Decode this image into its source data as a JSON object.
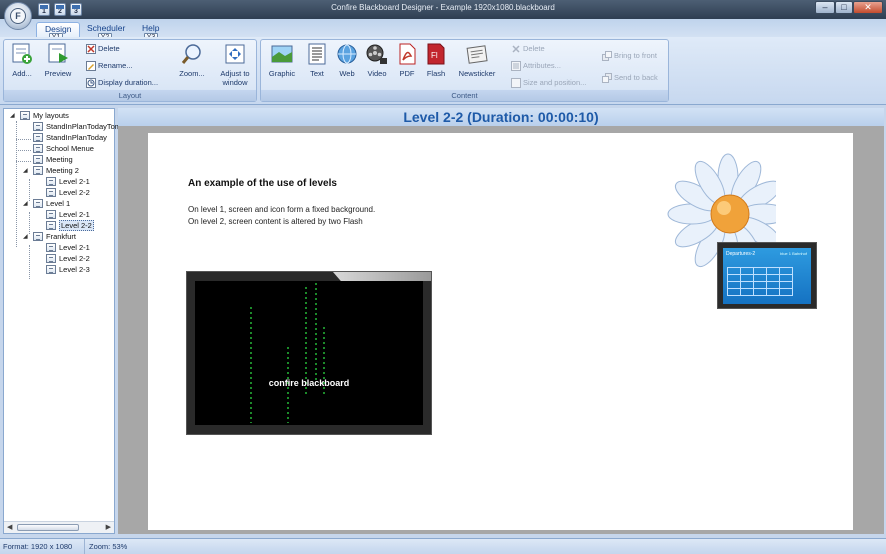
{
  "window": {
    "title": "Confire Blackboard Designer - Example 1920x1080.blackboard",
    "app_button_letter": "F",
    "quick_access": [
      "1",
      "2",
      "3"
    ],
    "controls": {
      "minimize": "–",
      "maximize": "□",
      "close": "✕"
    }
  },
  "tabs": [
    {
      "label": "Design",
      "keytip": "Y1"
    },
    {
      "label": "Scheduler",
      "keytip": "Y2"
    },
    {
      "label": "Help",
      "keytip": "Y3"
    }
  ],
  "ribbon": {
    "layout_group": {
      "label": "Layout",
      "add": "Add...",
      "preview": "Preview",
      "delete": "Delete",
      "rename": "Rename...",
      "display_duration": "Display duration...",
      "zoom": "Zoom...",
      "adjust": "Adjust to window"
    },
    "content_group": {
      "label": "Content",
      "graphic": "Graphic",
      "text": "Text",
      "web": "Web",
      "video": "Video",
      "pdf": "PDF",
      "flash": "Flash",
      "newsticker": "Newsticker",
      "delete": "Delete",
      "attributes": "Attributes...",
      "size_position": "Size and position...",
      "bring_front": "Bring to front",
      "send_back": "Send to back"
    }
  },
  "tree": {
    "root": "My layouts",
    "items": [
      "StandInPlanTodayTomorrow",
      "StandInPlanToday",
      "School Menue",
      "Meeting",
      "Meeting 2",
      "Level 2-1",
      "Level 2-2",
      "Level 1",
      "Level 2-1",
      "Level 2-2",
      "Frankfurt",
      "Level 2-1",
      "Level 2-2",
      "Level 2-3"
    ],
    "selected": "Level 2-2"
  },
  "view": {
    "header": "Level 2-2 (Duration: 00:00:10)",
    "content": {
      "heading": "An example of the use of levels",
      "line1": "On level 1, screen and icon form a fixed background.",
      "line2": "On level 2, screen content is altered by two Flash",
      "screen_caption": "confire blackboard",
      "monitor_title": "Departures-2",
      "monitor_time": "blue 1 Bahnhof"
    }
  },
  "status": {
    "format": "Format: 1920 x 1080",
    "zoom": "Zoom: 53%"
  },
  "colors": {
    "accent": "#1e5aa8",
    "ribbon": "#dae6f6",
    "canvas_bg": "#a7a7a7"
  }
}
